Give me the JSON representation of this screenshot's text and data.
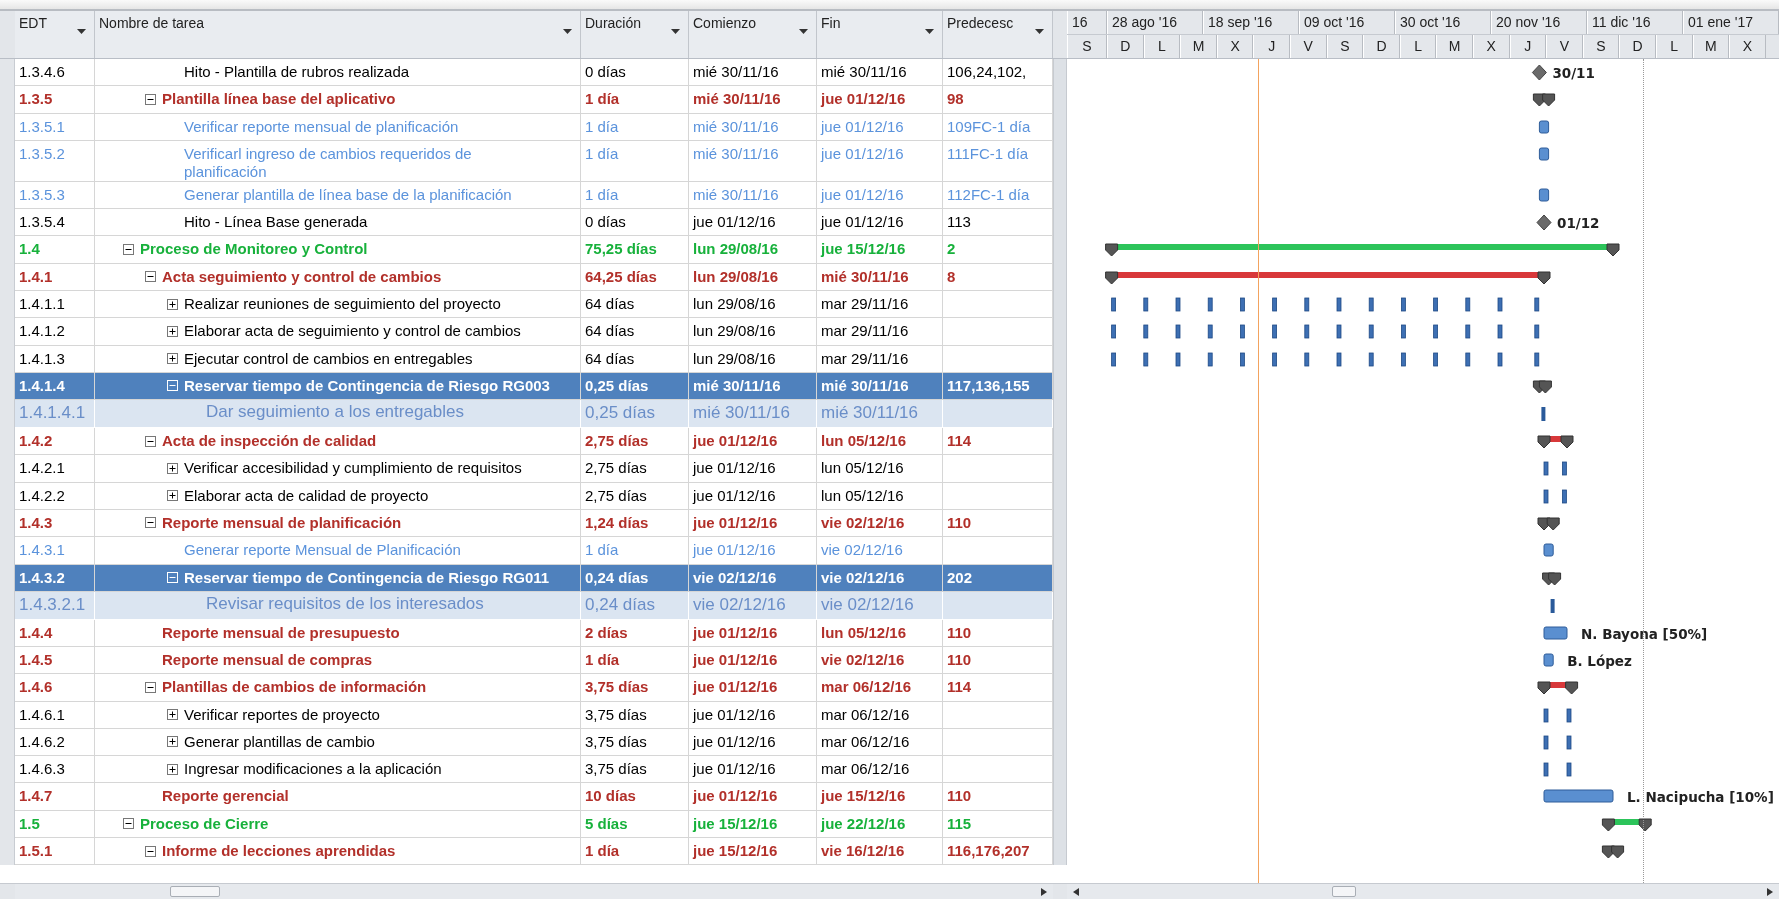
{
  "columns": [
    "EDT",
    "Nombre de tarea",
    "Duración",
    "Comienzo",
    "Fin",
    "Predecesc"
  ],
  "timescale": {
    "major": [
      "16",
      "28 ago '16",
      "18 sep '16",
      "09 oct '16",
      "30 oct '16",
      "20 nov '16",
      "11 dic '16",
      "01 ene '17"
    ],
    "minor": [
      "S",
      "D",
      "L",
      "M",
      "X",
      "J",
      "V",
      "S",
      "D",
      "L",
      "M",
      "X",
      "J",
      "V",
      "S",
      "D",
      "L",
      "M",
      "X"
    ]
  },
  "rows": [
    {
      "edt": "1.3.4.6",
      "name": "Hito - Plantilla de rubros realizada",
      "duration": "0 días",
      "start": "mié 30/11/16",
      "finish": "mié 30/11/16",
      "predecessors": "106,24,102,",
      "kind": "milestone",
      "selected": false,
      "gantt_label": "30/11"
    },
    {
      "edt": "1.3.5",
      "name": "Plantilla línea base del aplicativo",
      "duration": "1 día",
      "start": "mié 30/11/16",
      "finish": "jue 01/12/16",
      "predecessors": "98",
      "kind": "critical-summary",
      "selected": false,
      "expanded": true,
      "children": [
        {
          "edt": "1.3.5.1",
          "name": "Verificar reporte mensual de planificación",
          "duration": "1 día",
          "start": "mié 30/11/16",
          "finish": "jue 01/12/16",
          "predecessors": "109FC-1 día",
          "kind": "inactive-task",
          "selected": false
        },
        {
          "edt": "1.3.5.2",
          "name": "Verificarl ingreso de cambios requeridos de planificación",
          "duration": "1 día",
          "start": "mié 30/11/16",
          "finish": "jue 01/12/16",
          "predecessors": "111FC-1 día",
          "kind": "inactive-task",
          "selected": false
        },
        {
          "edt": "1.3.5.3",
          "name": "Generar plantilla de línea base de la planificación",
          "duration": "1 día",
          "start": "mié 30/11/16",
          "finish": "jue 01/12/16",
          "predecessors": "112FC-1 día",
          "kind": "inactive-task",
          "selected": false
        },
        {
          "edt": "1.3.5.4",
          "name": "Hito - Línea Base generada",
          "duration": "0 días",
          "start": "jue 01/12/16",
          "finish": "jue 01/12/16",
          "predecessors": "113",
          "kind": "milestone",
          "selected": false,
          "gantt_label": "01/12"
        }
      ]
    },
    {
      "edt": "1.4",
      "name": "Proceso de Monitoreo y Control",
      "duration": "75,25 días",
      "start": "lun 29/08/16",
      "finish": "jue 15/12/16",
      "predecessors": "2",
      "kind": "phase",
      "selected": false,
      "expanded": true,
      "children": [
        {
          "edt": "1.4.1",
          "name": "Acta seguimiento y control de cambios",
          "duration": "64,25 días",
          "start": "lun 29/08/16",
          "finish": "mié 30/11/16",
          "predecessors": "8",
          "kind": "critical-summary",
          "selected": false,
          "expanded": true,
          "children": [
            {
              "edt": "1.4.1.1",
              "name": "Realizar reuniones de seguimiento del proyecto",
              "duration": "64 días",
              "start": "lun 29/08/16",
              "finish": "mar 29/11/16",
              "kind": "task",
              "selected": false,
              "expanded": false
            },
            {
              "edt": "1.4.1.2",
              "name": "Elaborar acta de seguimiento y control de cambios",
              "duration": "64 días",
              "start": "lun 29/08/16",
              "finish": "mar 29/11/16",
              "kind": "task",
              "selected": false,
              "expanded": false
            },
            {
              "edt": "1.4.1.3",
              "name": "Ejecutar control de cambios en entregables",
              "duration": "64 días",
              "start": "lun 29/08/16",
              "finish": "mar 29/11/16",
              "kind": "task",
              "selected": false,
              "expanded": false
            },
            {
              "edt": "1.4.1.4",
              "name": "Reservar tiempo de Contingencia de Riesgo RG003",
              "duration": "0,25 días",
              "start": "mié 30/11/16",
              "finish": "mié 30/11/16",
              "predecessors": "117,136,155",
              "kind": "summary",
              "selected": true,
              "expanded": true,
              "children": [
                {
                  "edt": "1.4.1.4.1",
                  "name": "Dar seguimiento a los entregables",
                  "duration": "0,25 días",
                  "start": "mié 30/11/16",
                  "finish": "mié 30/11/16",
                  "kind": "assignment",
                  "selected": false
                }
              ]
            }
          ]
        },
        {
          "edt": "1.4.2",
          "name": "Acta de inspección de calidad",
          "duration": "2,75 días",
          "start": "jue 01/12/16",
          "finish": "lun 05/12/16",
          "predecessors": "114",
          "kind": "critical-summary",
          "selected": false,
          "expanded": true,
          "children": [
            {
              "edt": "1.4.2.1",
              "name": "Verificar accesibilidad y cumplimiento de requisitos",
              "duration": "2,75 días",
              "start": "jue 01/12/16",
              "finish": "lun 05/12/16",
              "kind": "task",
              "selected": false,
              "expanded": false
            },
            {
              "edt": "1.4.2.2",
              "name": "Elaborar acta de calidad de proyecto",
              "duration": "2,75 días",
              "start": "jue 01/12/16",
              "finish": "lun 05/12/16",
              "kind": "task",
              "selected": false,
              "expanded": false
            }
          ]
        },
        {
          "edt": "1.4.3",
          "name": "Reporte mensual de planificación",
          "duration": "1,24 días",
          "start": "jue 01/12/16",
          "finish": "vie 02/12/16",
          "predecessors": "110",
          "kind": "critical-summary",
          "selected": false,
          "expanded": true,
          "children": [
            {
              "edt": "1.4.3.1",
              "name": "Generar reporte Mensual de Planificación",
              "duration": "1 día",
              "start": "jue 01/12/16",
              "finish": "vie 02/12/16",
              "kind": "inactive-task",
              "selected": false
            },
            {
              "edt": "1.4.3.2",
              "name": "Reservar tiempo de Contingencia de Riesgo RG011",
              "duration": "0,24 días",
              "start": "vie 02/12/16",
              "finish": "vie 02/12/16",
              "predecessors": "202",
              "kind": "summary",
              "selected": true,
              "expanded": true,
              "children": [
                {
                  "edt": "1.4.3.2.1",
                  "name": "Revisar requisitos de los interesados",
                  "duration": "0,24 días",
                  "start": "vie 02/12/16",
                  "finish": "vie 02/12/16",
                  "kind": "assignment",
                  "selected": false
                }
              ]
            }
          ]
        },
        {
          "edt": "1.4.4",
          "name": "Reporte mensual de presupuesto",
          "duration": "2 días",
          "start": "jue 01/12/16",
          "finish": "lun 05/12/16",
          "predecessors": "110",
          "kind": "critical-task",
          "selected": false,
          "gantt_label": "N. Bayona [50%]"
        },
        {
          "edt": "1.4.5",
          "name": "Reporte mensual de compras",
          "duration": "1 día",
          "start": "jue 01/12/16",
          "finish": "vie 02/12/16",
          "predecessors": "110",
          "kind": "critical-task",
          "selected": false,
          "gantt_label": "B. López"
        },
        {
          "edt": "1.4.6",
          "name": "Plantillas de cambios de información",
          "duration": "3,75 días",
          "start": "jue 01/12/16",
          "finish": "mar 06/12/16",
          "predecessors": "114",
          "kind": "critical-summary",
          "selected": false,
          "expanded": true,
          "children": [
            {
              "edt": "1.4.6.1",
              "name": "Verificar reportes de proyecto",
              "duration": "3,75 días",
              "start": "jue 01/12/16",
              "finish": "mar 06/12/16",
              "kind": "task",
              "selected": false,
              "expanded": false
            },
            {
              "edt": "1.4.6.2",
              "name": "Generar plantillas de cambio",
              "duration": "3,75 días",
              "start": "jue 01/12/16",
              "finish": "mar 06/12/16",
              "kind": "task",
              "selected": false,
              "expanded": false
            },
            {
              "edt": "1.4.6.3",
              "name": "Ingresar modificaciones a la aplicación",
              "duration": "3,75 días",
              "start": "jue 01/12/16",
              "finish": "mar 06/12/16",
              "kind": "task",
              "selected": false,
              "expanded": false
            }
          ]
        },
        {
          "edt": "1.4.7",
          "name": "Reporte gerencial",
          "duration": "10 días",
          "start": "jue 01/12/16",
          "finish": "jue 15/12/16",
          "predecessors": "110",
          "kind": "critical-task",
          "selected": false,
          "gantt_label": "L. Nacipucha [10%]"
        }
      ]
    },
    {
      "edt": "1.5",
      "name": "Proceso de Cierre",
      "duration": "5 días",
      "start": "jue 15/12/16",
      "finish": "jue 22/12/16",
      "predecessors": "115",
      "kind": "phase",
      "selected": false,
      "expanded": true,
      "children": [
        {
          "edt": "1.5.1",
          "name": "Informe de lecciones aprendidas",
          "duration": "1 día",
          "start": "jue 15/12/16",
          "finish": "vie 16/12/16",
          "predecessors": "116,176,207",
          "kind": "critical-summary",
          "selected": false,
          "expanded": true
        }
      ]
    }
  ]
}
